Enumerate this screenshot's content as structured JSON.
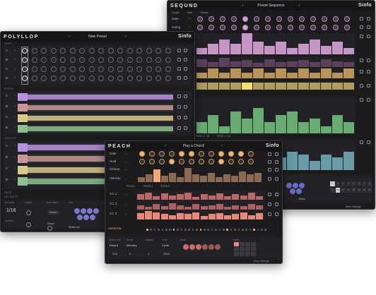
{
  "colors": {
    "window_bg": "#1c1c1f",
    "panel_bg": "#222226",
    "polyllop_lanes": [
      "#b892e0",
      "#c89696",
      "#d8c88a",
      "#8ec08e"
    ],
    "seqund_lanes": [
      "#d4a0d4",
      "#c8a060",
      "#6fb878",
      "#6fa6b0"
    ],
    "peach_accent": "#f0b878",
    "peach_velocity": "#e88878"
  },
  "polyllop": {
    "brand": "POLYLLOP",
    "preset": "New Preset",
    "logo": "Sinfo",
    "sections": [
      "GATE",
      "PITCH",
      "LENGTH",
      "RATE",
      "VELOCITY"
    ],
    "lanes": [
      "A",
      "B",
      "C",
      "D"
    ],
    "rate_value": "1/16",
    "bottom_labels": [
      "RHYTHM",
      "SWING",
      "SKIP STEPS",
      "PAD",
      "OCTAVE"
    ],
    "mode": "Chord",
    "option_label": "Reset Len",
    "option_label2": "Chord"
  },
  "seqund": {
    "brand": "SEQUND",
    "preset": "Preset Sequence",
    "logo": "Sinfo",
    "toolbar": [
      "Length",
      "Rate",
      "Thema"
    ],
    "rows": [
      "Gate",
      "Swing"
    ],
    "page_labels": [
      "Pitch",
      "Velocity"
    ],
    "tabs": [
      "PAGE 1 / 16",
      "PAGE 2 / 16"
    ],
    "step_numbers": [
      "1",
      "2",
      "3",
      "4",
      "5",
      "6",
      "7",
      "8"
    ],
    "step_numbers2": [
      "9",
      "10",
      "11",
      "12",
      "13",
      "14",
      "15",
      "16"
    ],
    "dropdown": "Mirror",
    "footer": "Sinfo Settings"
  },
  "peach": {
    "brand": "PEACH",
    "preset": "Play a Chord!",
    "logo": "Sinfo",
    "rows": [
      "Gate",
      "Hold",
      "Octave",
      "Velocity"
    ],
    "cc_rows": [
      "CC 1",
      "CC 2",
      "CC 3"
    ],
    "tabs": [
      "PROB 1",
      "PROB 2",
      "PROB 3"
    ],
    "variation": "VARIATION",
    "bottom_labels": [
      "BASIC SEQ",
      "MODE",
      "SIGNED",
      "TYPE",
      "STEPS",
      "PADS"
    ],
    "mode_values": [
      "Played",
      "Memory",
      "Cycle"
    ],
    "numbers": [
      "1/16",
      "8",
      "2",
      "16/16"
    ],
    "footer": "Sinfo Settings"
  }
}
